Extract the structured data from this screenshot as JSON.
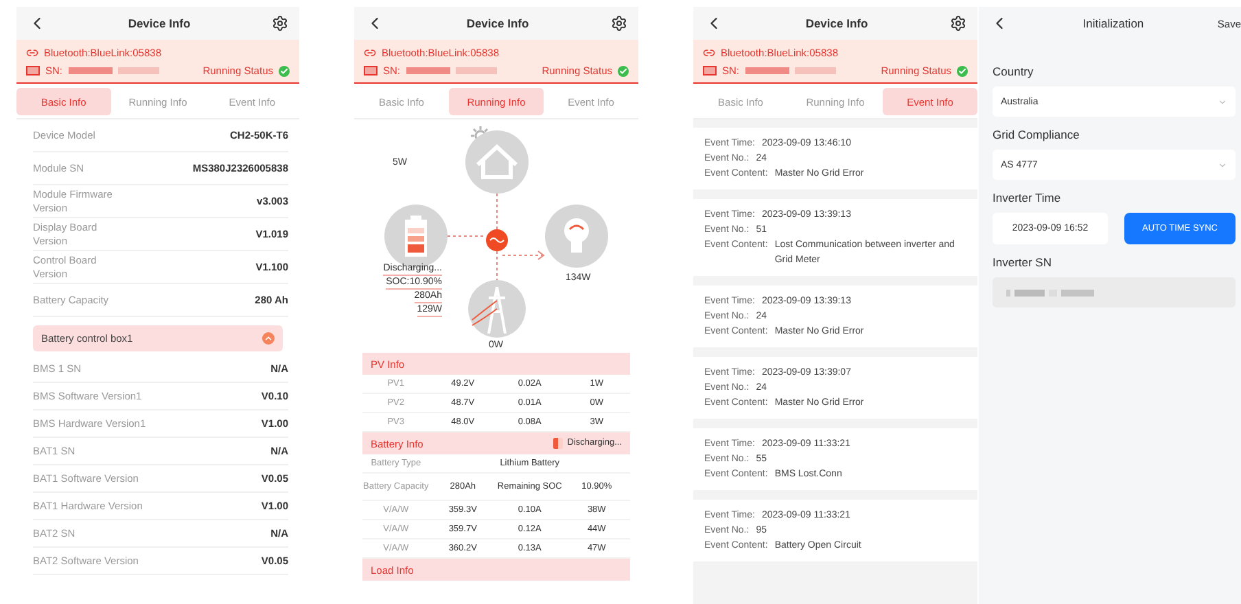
{
  "basic_screen": {
    "header": {
      "title": "Device Info",
      "bluetooth": "Bluetooth:BlueLink:05838",
      "sn_label": "SN:",
      "status": "Running Status",
      "status_ok": true,
      "tabs": [
        {
          "label": "Basic Info",
          "selected": true
        },
        {
          "label": "Running Info",
          "selected": false
        },
        {
          "label": "Event Info",
          "selected": false
        }
      ]
    },
    "rows": [
      {
        "label": "Device Model",
        "value": "CH2-50K-T6"
      },
      {
        "label": "Module SN",
        "value": "MS380J2326005838"
      },
      {
        "label": "Module Firmware Version",
        "value": "v3.003"
      },
      {
        "label": "Display Board Version",
        "value": "V1.019"
      },
      {
        "label": "Control Board Version",
        "value": "V1.100"
      },
      {
        "label": "Battery Capacity",
        "value": "280 Ah"
      }
    ],
    "section": {
      "title": "Battery control box1",
      "expanded": true
    },
    "battery_rows": [
      {
        "label": "BMS 1 SN",
        "value": "N/A"
      },
      {
        "label": "BMS Software Version1",
        "value": "V0.10"
      },
      {
        "label": "BMS Hardware Version1",
        "value": "V1.00"
      },
      {
        "label": "BAT1 SN",
        "value": "N/A"
      },
      {
        "label": "BAT1 Software Version",
        "value": "V0.05"
      },
      {
        "label": "BAT1 Hardware Version",
        "value": "V1.00"
      },
      {
        "label": "BAT2 SN",
        "value": "N/A"
      },
      {
        "label": "BAT2 Software Version",
        "value": "V0.05"
      }
    ]
  },
  "running_screen": {
    "header": {
      "title": "Device Info",
      "bluetooth": "Bluetooth:BlueLink:05838",
      "sn_label": "SN:",
      "status": "Running Status",
      "status_ok": true,
      "tabs": [
        {
          "label": "Basic Info",
          "selected": false
        },
        {
          "label": "Running Info",
          "selected": true
        },
        {
          "label": "Event Info",
          "selected": false
        }
      ]
    },
    "diagram": {
      "pv_power": "5W",
      "battery_state": "Discharging...",
      "soc": "SOC:10.90%",
      "capacity": "280Ah",
      "battery_power": "129W",
      "load_power": "134W",
      "grid_power": "0W"
    },
    "pv_info": {
      "title": "PV Info",
      "rows": [
        [
          "PV1",
          "49.2V",
          "0.02A",
          "1W"
        ],
        [
          "PV2",
          "48.7V",
          "0.01A",
          "0W"
        ],
        [
          "PV3",
          "48.0V",
          "0.08A",
          "3W"
        ]
      ]
    },
    "battery_info": {
      "title": "Battery Info",
      "state": "Discharging...",
      "type_label": "Battery Type",
      "type_value": "Lithium Battery",
      "capacity_label": "Battery Capacity",
      "capacity_value": "280Ah",
      "soc_label": "Remaining SOC",
      "soc_value": "10.90%",
      "rows": [
        [
          "V/A/W",
          "359.3V",
          "0.10A",
          "38W"
        ],
        [
          "V/A/W",
          "359.7V",
          "0.12A",
          "44W"
        ],
        [
          "V/A/W",
          "360.2V",
          "0.13A",
          "47W"
        ]
      ]
    },
    "load_info": {
      "title": "Load Info"
    }
  },
  "event_screen": {
    "header": {
      "title": "Device Info",
      "bluetooth": "Bluetooth:BlueLink:05838",
      "sn_label": "SN:",
      "status": "Running Status",
      "status_ok": true,
      "tabs": [
        {
          "label": "Basic Info",
          "selected": false
        },
        {
          "label": "Running Info",
          "selected": false
        },
        {
          "label": "Event Info",
          "selected": true
        }
      ]
    },
    "events": [
      {
        "time_label": "Event Time:",
        "time": "2023-09-09 13:46:10",
        "no_label": "Event No.:",
        "no": "24",
        "content_label": "Event Content:",
        "content": "Master No Grid Error"
      },
      {
        "time_label": "Event Time:",
        "time": "2023-09-09 13:39:13",
        "no_label": "Event No.:",
        "no": "51",
        "content_label": "Event Content:",
        "content": "Lost Communication between inverter and Grid Meter"
      },
      {
        "time_label": "Event Time:",
        "time": "2023-09-09 13:39:13",
        "no_label": "Event No.:",
        "no": "24",
        "content_label": "Event Content:",
        "content": "Master No Grid Error"
      },
      {
        "time_label": "Event Time:",
        "time": "2023-09-09 13:39:07",
        "no_label": "Event No.:",
        "no": "24",
        "content_label": "Event Content:",
        "content": "Master No Grid Error"
      },
      {
        "time_label": "Event Time:",
        "time": "2023-09-09 11:33:21",
        "no_label": "Event No.:",
        "no": "55",
        "content_label": "Event Content:",
        "content": "BMS Lost.Conn"
      },
      {
        "time_label": "Event Time:",
        "time": "2023-09-09 11:33:21",
        "no_label": "Event No.:",
        "no": "95",
        "content_label": "Event Content:",
        "content": "Battery Open Circuit"
      }
    ]
  },
  "init_screen": {
    "title": "Initialization",
    "save": "Save",
    "country": {
      "label": "Country",
      "value": "Australia"
    },
    "grid": {
      "label": "Grid Compliance",
      "value": "AS 4777"
    },
    "time": {
      "label": "Inverter Time",
      "value": "2023-09-09 16:52",
      "button": "AUTO TIME SYNC"
    },
    "sn": {
      "label": "Inverter SN",
      "disabled": true
    }
  }
}
